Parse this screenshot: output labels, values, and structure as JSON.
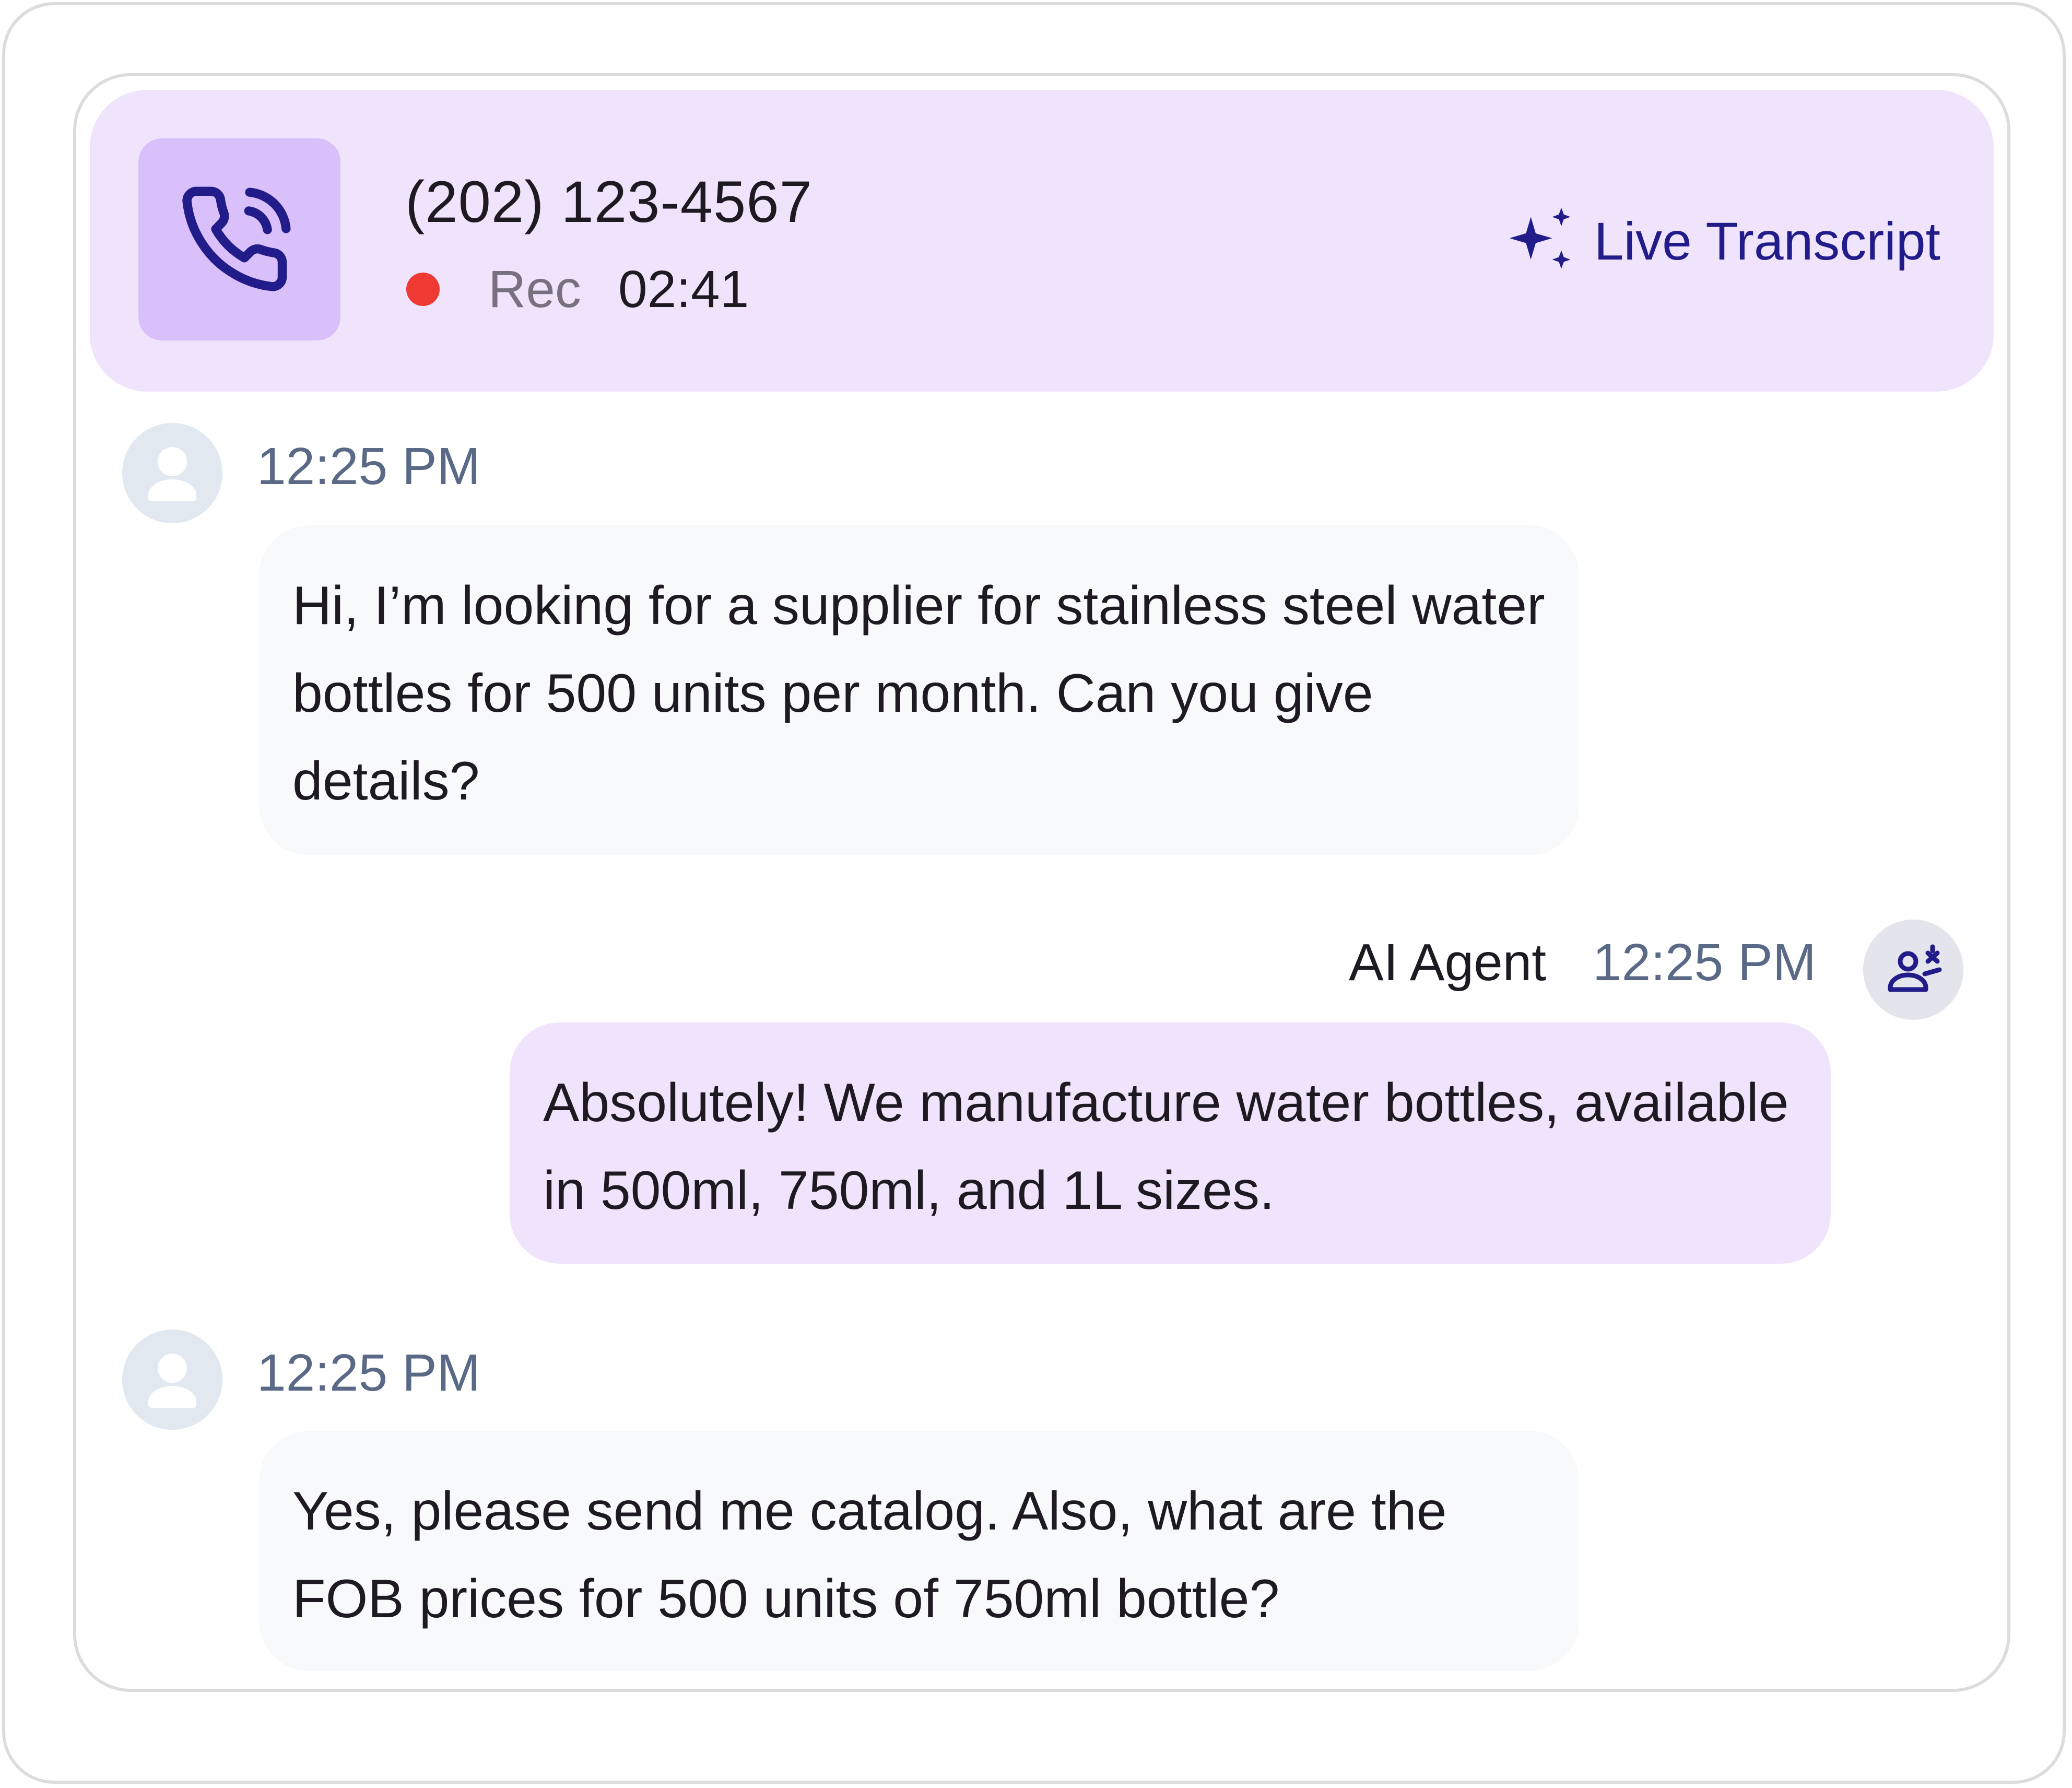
{
  "call": {
    "phone_number": "(202) 123-4567",
    "rec_label": "Rec",
    "rec_time": "02:41",
    "transcript_label": "Live Transcript"
  },
  "messages": [
    {
      "sender": "caller",
      "time": "12:25 PM",
      "text": "Hi, I’m looking for a supplier for stainless steel water bottles for 500 units per month. Can you give details?"
    },
    {
      "sender": "agent",
      "name": "AI Agent",
      "time": "12:25 PM",
      "text": "Absolutely! We manufacture water bottles, available in 500ml, 750ml, and 1L sizes."
    },
    {
      "sender": "caller",
      "time": "12:25 PM",
      "text": "Yes, please send me catalog. Also, what are the FOB prices for 500 units of 750ml bottle?"
    }
  ],
  "icons": {
    "call": "phone-call-icon",
    "transcript": "sparkles-icon",
    "caller_avatar": "user-avatar-icon",
    "agent_avatar": "ai-agent-avatar-icon"
  },
  "colors": {
    "accent": "#221c8a",
    "header_bg": "#f0e4fd",
    "phone_box_bg": "#d9c0fb",
    "recording": "#ef3a33",
    "agent_bubble": "#f0e4fd",
    "caller_bubble": "#f8f9fb"
  }
}
